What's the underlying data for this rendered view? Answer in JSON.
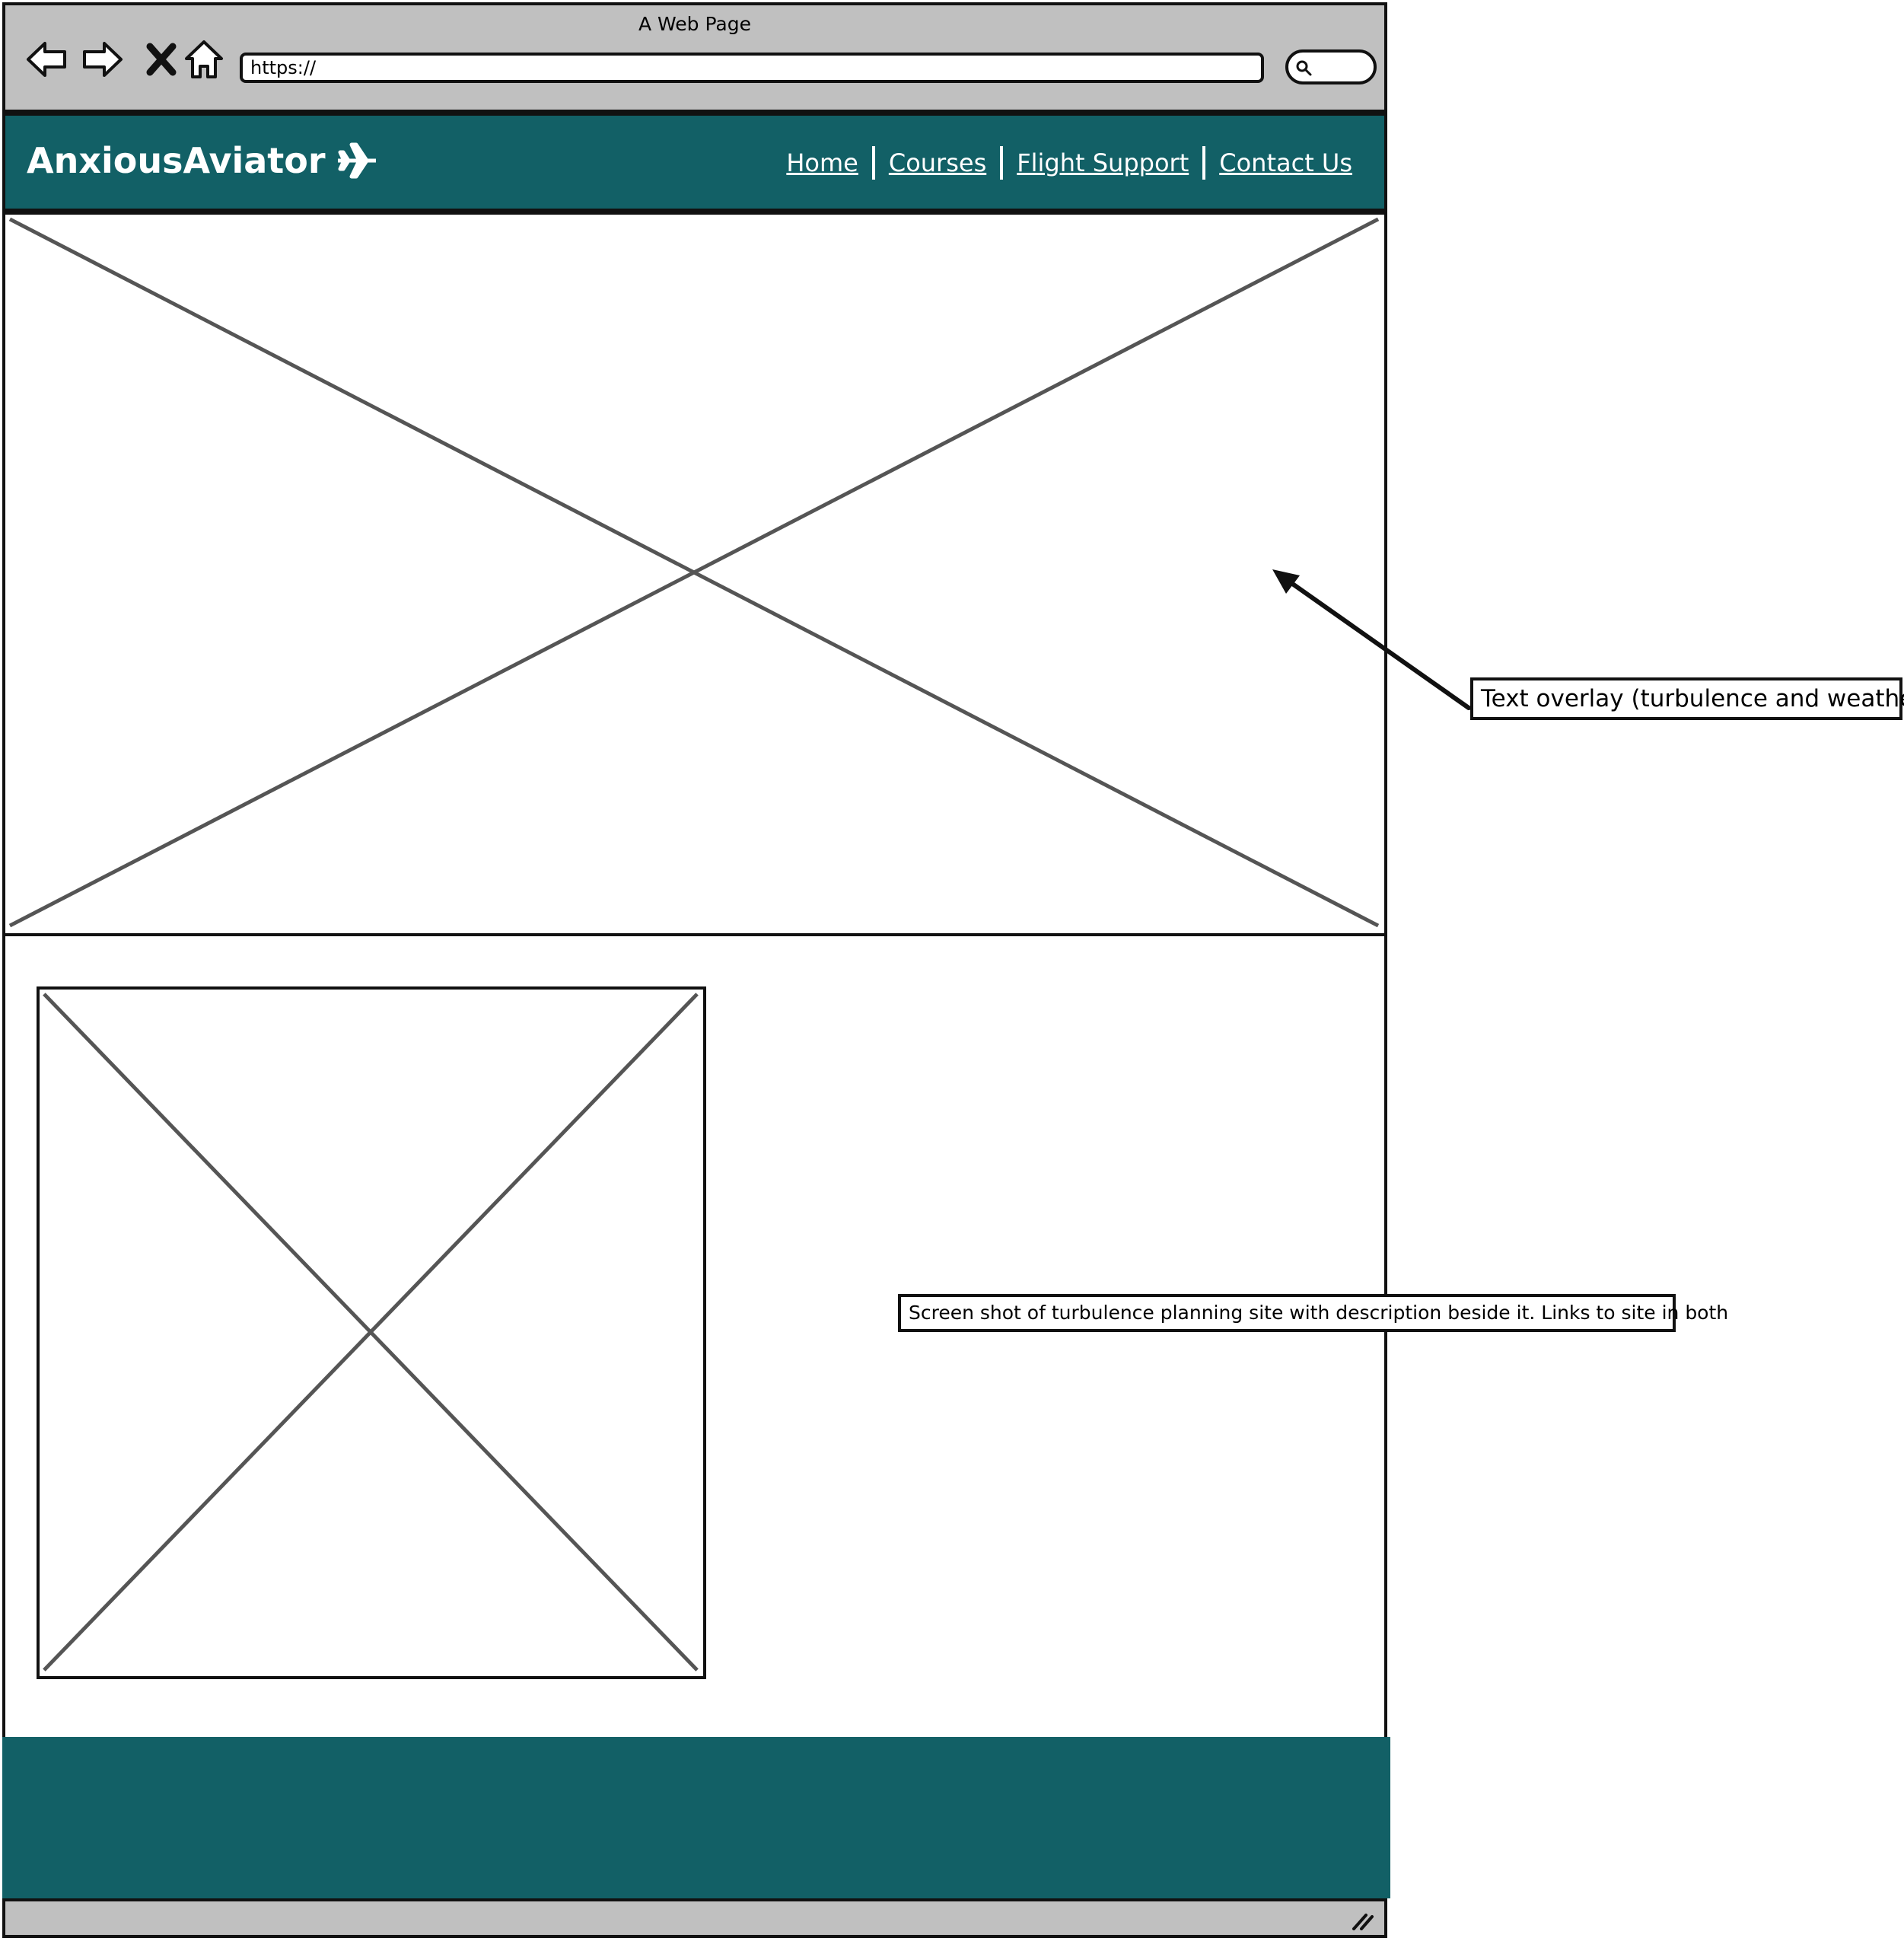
{
  "browser": {
    "window_title": "A Web Page",
    "url": "https://",
    "icons": {
      "back": "back-arrow-icon",
      "forward": "forward-arrow-icon",
      "stop": "close-icon",
      "home": "home-icon",
      "search": "search-icon",
      "resize": "resize-grip-icon"
    }
  },
  "header": {
    "brand": "AnxiousAviator",
    "brand_icon": "airplane-icon",
    "nav": [
      "Home",
      "Courses",
      "Flight Support",
      "Contact Us"
    ]
  },
  "annotations": {
    "hero_note": "Text overlay (turbulence and weather)",
    "screenshot_note": "Screen shot of turbulence planning site with description beside it. Links to site in both"
  },
  "colors": {
    "brand_teal": "#126066",
    "chrome_gray": "#c0c0c0",
    "placeholder_line": "#555555"
  }
}
